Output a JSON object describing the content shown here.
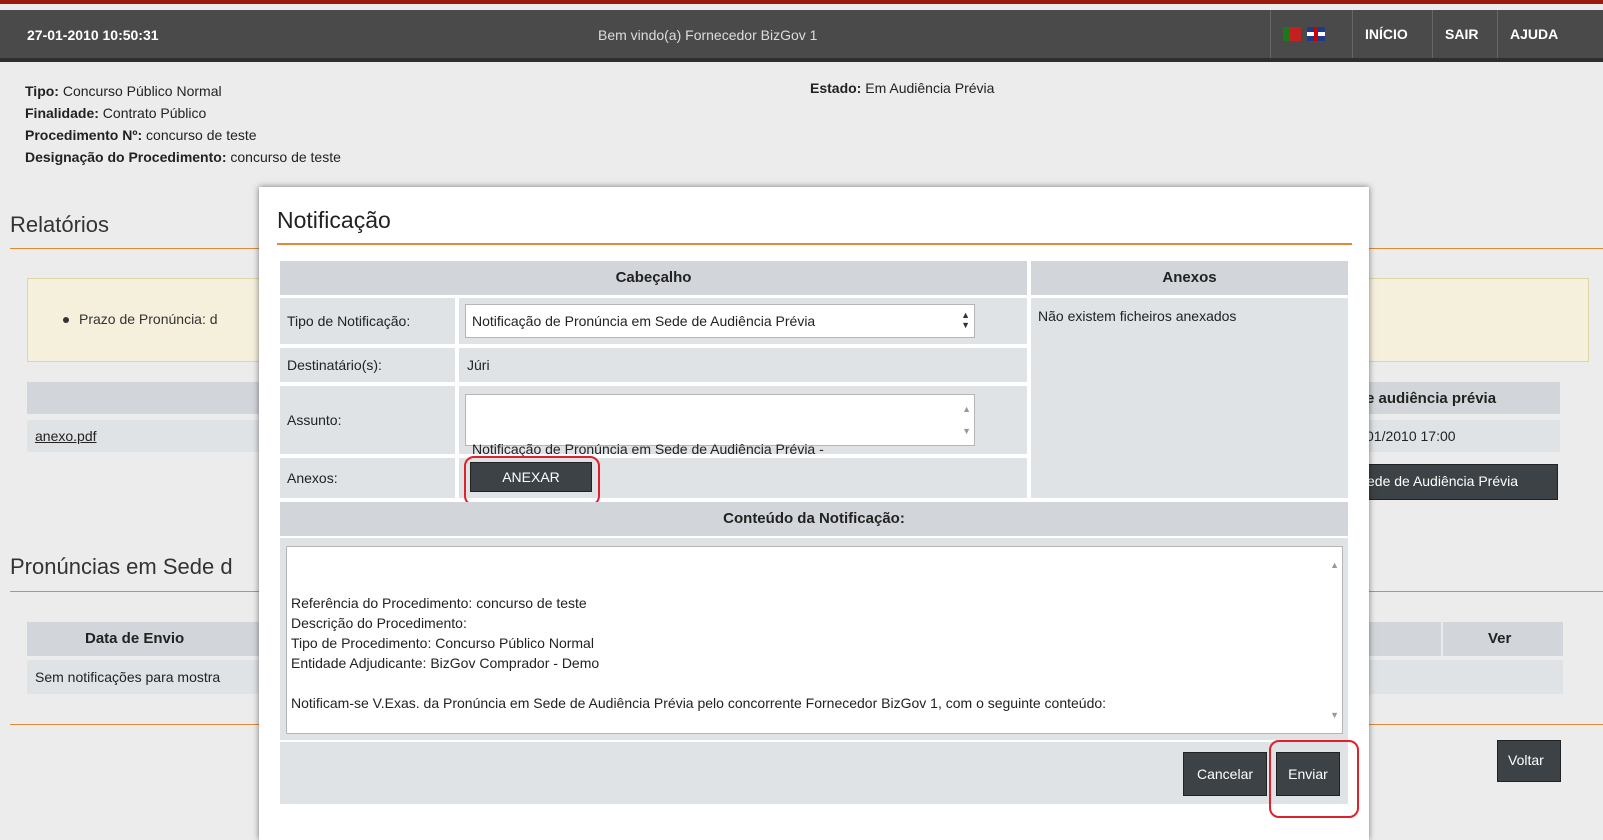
{
  "header": {
    "datetime": "27-01-2010 10:50:31",
    "welcome": "Bem vindo(a) Fornecedor BizGov 1",
    "nav": [
      "INÍCIO",
      "SAIR",
      "AJUDA"
    ]
  },
  "info": {
    "tipo_label": "Tipo:",
    "tipo_value": "Concurso Público Normal",
    "finalidade_label": "Finalidade:",
    "finalidade_value": "Contrato Público",
    "procedimento_label": "Procedimento Nº:",
    "procedimento_value": "concurso de teste",
    "designacao_label": "Designação do Procedimento:",
    "designacao_value": "concurso de teste",
    "estado_label": "Estado:",
    "estado_value": "Em Audiência Prévia"
  },
  "background": {
    "relatorios_title": "Relatórios",
    "prazo_text": "Prazo de Pronúncia: d",
    "link_anexo": "anexo.pdf",
    "audiencia_header": "e audiência prévia",
    "audiencia_date": "01/2010 17:00",
    "sede_btn": "ede de Audiência Prévia",
    "pronuncias_title": "Pronúncias em Sede d",
    "data_envio_header": "Data de Envio",
    "ver_header": "Ver",
    "sem_notificacoes": "Sem notificações para mostra",
    "voltar_btn": "Voltar"
  },
  "modal": {
    "title": "Notificação",
    "cabecalho_header": "Cabeçalho",
    "anexos_header": "Anexos",
    "tipo_label": "Tipo de Notificação:",
    "tipo_value": "Notificação de Pronúncia em Sede de Audiência Prévia",
    "destinatarios_label": "Destinatário(s):",
    "destinatarios_value": "Júri",
    "assunto_label": "Assunto:",
    "assunto_value": "Notificação de Pronúncia em Sede de Audiência Prévia -\nProcedimento concurso de teste.",
    "anexos_label": "Anexos:",
    "anexar_btn": "ANEXAR",
    "no_files": "Não existem ficheiros anexados",
    "conteudo_header": "Conteúdo da Notificação:",
    "conteudo_value": "Referência do Procedimento: concurso de teste\nDescrição do Procedimento:\nTipo de Procedimento: Concurso Público Normal\nEntidade Adjudicante: BizGov Comprador - Demo\n\nNotificam-se V.Exas. da Pronúncia em Sede de Audiência Prévia pelo concorrente Fornecedor BizGov 1, com o seguinte conteúdo:",
    "cancelar_btn": "Cancelar",
    "enviar_btn": "Enviar"
  },
  "colors": {
    "accent_orange": "#e08a3a",
    "highlight_red": "#e0202a",
    "button_dark": "#3c4246"
  }
}
